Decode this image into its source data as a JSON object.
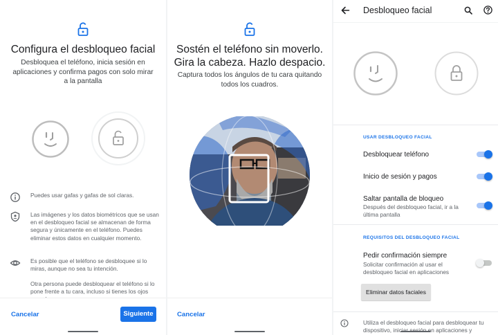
{
  "screen1": {
    "title": "Configura el desbloqueo facial",
    "subtitle": "Desbloquea el teléfono, inicia sesión en aplicaciones y confirma pagos con solo mirar a la pantalla",
    "info": [
      {
        "icon": "info-icon",
        "text": "Puedes usar gafas y gafas de sol claras."
      },
      {
        "icon": "shield-person-icon",
        "text": "Las imágenes y los datos biométricos que se usan en el desbloqueo facial se almacenan de forma segura y únicamente en el teléfono. Puedes eliminar estos datos en cualquier momento."
      },
      {
        "icon": "eye-icon",
        "text": "Es posible que el teléfono se desbloquee si lo miras, aunque no sea tu intención."
      },
      {
        "icon": "",
        "text": "Otra persona puede desbloquear el teléfono si lo pone frente a tu cara, incluso si tienes los ojos cerrados."
      }
    ],
    "cancel_label": "Cancelar",
    "next_label": "Siguiente"
  },
  "screen2": {
    "title_line1": "Sostén el teléfono sin moverlo.",
    "title_line2": "Gira la cabeza. Hazlo despacio.",
    "subtitle": "Captura todos los ángulos de tu cara quitando todos los cuadros.",
    "cancel_label": "Cancelar"
  },
  "screen3": {
    "app_title": "Desbloqueo facial",
    "section1": "USAR DESBLOQUEO FACIAL",
    "settings": [
      {
        "title": "Desbloquear teléfono",
        "subtitle": "",
        "enabled": true
      },
      {
        "title": "Inicio de sesión y pagos",
        "subtitle": "",
        "enabled": true
      },
      {
        "title": "Saltar pantalla de bloqueo",
        "subtitle": "Después del desbloqueo facial, ir a la última pantalla",
        "enabled": true
      }
    ],
    "section2": "REQUISITOS DEL DESBLOQUEO FACIAL",
    "requirement": {
      "title": "Pedir confirmación siempre",
      "subtitle": "Solicitar confirmación al usar el desbloqueo facial en aplicaciones",
      "enabled": false
    },
    "delete_label": "Eliminar datos faciales",
    "footer_text": "Utiliza el desbloqueo facial para desbloquear tu dispositivo, iniciar sesión en aplicaciones y"
  },
  "colors": {
    "accent": "#1a73e8",
    "circle_grey": "#bdbdbd"
  }
}
